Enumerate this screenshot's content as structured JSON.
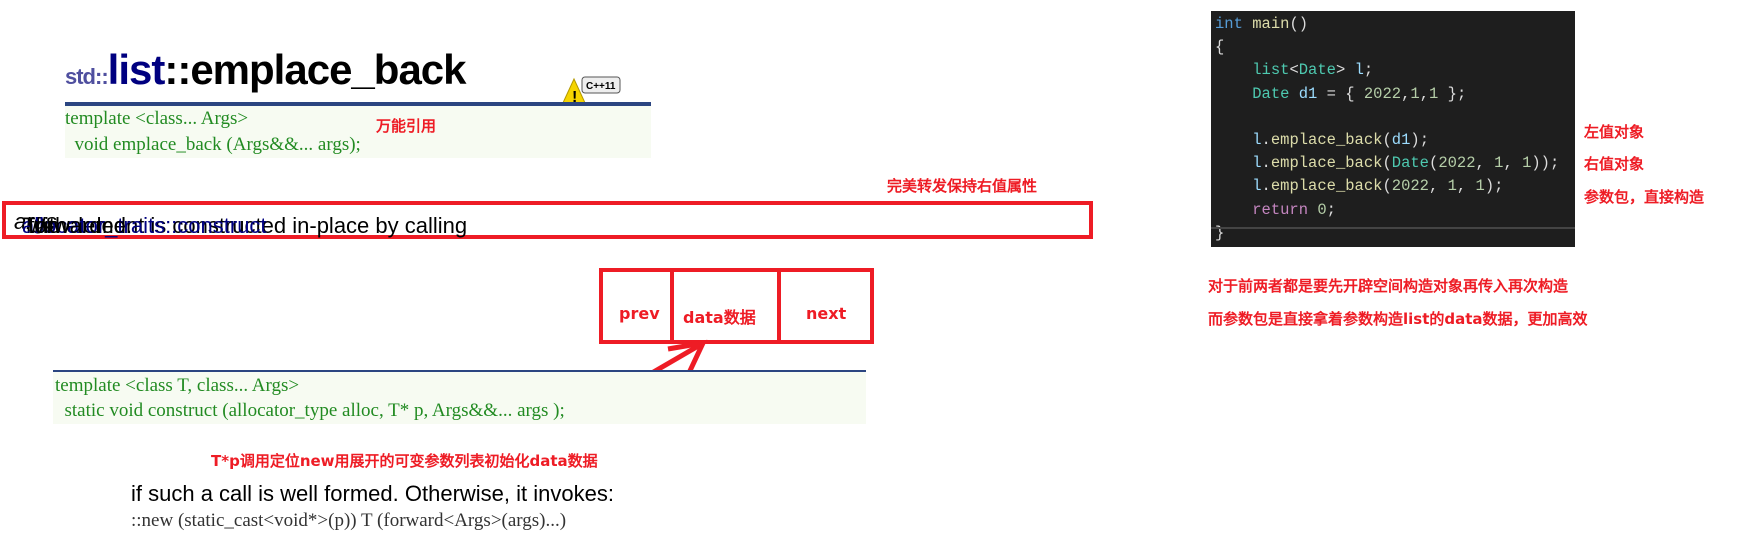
{
  "doc": {
    "title_ns": "std::",
    "title_class": "list",
    "title_sep": "::",
    "title_member": "emplace_back",
    "badge": "C++11",
    "sig_line1": "template <class... Args>",
    "sig_line2": "  void emplace_back (Args&&... args);",
    "desc_pre": "The element is constructed in-place by calling ",
    "desc_link": "allocator_traits::construct",
    "desc_mid": " with ",
    "desc_em": "args",
    "desc_post": " forwarded.",
    "construct_line1": "template <class T, class... Args>",
    "construct_line2": "  static void construct (allocator_type alloc, T* p, Args&&... args );",
    "otherwise": "if such a call is well formed. Otherwise, it invokes:",
    "new_expr": "::new (static_cast<void*>(p)) T (forward<Args>(args)...)"
  },
  "annotations": {
    "universal_ref": "万能引用",
    "perfect_forward": "完美转发保持右值属性",
    "placement_new": "T*p调用定位new用展开的可变参数列表初始化data数据",
    "lvalue": "左值对象",
    "rvalue": "右值对象",
    "pack": "参数包，直接构造",
    "note1": "对于前两者都是要先开辟空间构造对象再传入再次构造",
    "note2": "而参数包是直接拿着参数构造list的data数据，更加高效"
  },
  "node": {
    "prev": "prev",
    "data": "data数据",
    "next": "next"
  },
  "code": [
    [
      [
        "int",
        "kw"
      ],
      [
        " ",
        "p"
      ],
      [
        "main",
        "fn"
      ],
      [
        "()",
        "p"
      ]
    ],
    [
      [
        "{",
        "p"
      ]
    ],
    [
      [
        "    ",
        "p"
      ],
      [
        "list",
        "ty"
      ],
      [
        "<",
        "p"
      ],
      [
        "Date",
        "ty"
      ],
      [
        "> ",
        "p"
      ],
      [
        "l",
        "var"
      ],
      [
        ";",
        "p"
      ]
    ],
    [
      [
        "    ",
        "p"
      ],
      [
        "Date",
        "ty"
      ],
      [
        " ",
        "p"
      ],
      [
        "d1",
        "var"
      ],
      [
        " = { ",
        "p"
      ],
      [
        "2022",
        "num"
      ],
      [
        ",",
        "p"
      ],
      [
        "1",
        "num"
      ],
      [
        ",",
        "p"
      ],
      [
        "1",
        "num"
      ],
      [
        " };",
        "p"
      ]
    ],
    [],
    [
      [
        "    ",
        "p"
      ],
      [
        "l",
        "var"
      ],
      [
        ".",
        "p"
      ],
      [
        "emplace_back",
        "fn"
      ],
      [
        "(",
        "p"
      ],
      [
        "d1",
        "var"
      ],
      [
        ");",
        "p"
      ]
    ],
    [
      [
        "    ",
        "p"
      ],
      [
        "l",
        "var"
      ],
      [
        ".",
        "p"
      ],
      [
        "emplace_back",
        "fn"
      ],
      [
        "(",
        "p"
      ],
      [
        "Date",
        "ty"
      ],
      [
        "(",
        "p"
      ],
      [
        "2022",
        "num"
      ],
      [
        ", ",
        "p"
      ],
      [
        "1",
        "num"
      ],
      [
        ", ",
        "p"
      ],
      [
        "1",
        "num"
      ],
      [
        "));",
        "p"
      ]
    ],
    [
      [
        "    ",
        "p"
      ],
      [
        "l",
        "var"
      ],
      [
        ".",
        "p"
      ],
      [
        "emplace_back",
        "fn"
      ],
      [
        "(",
        "p"
      ],
      [
        "2022",
        "num"
      ],
      [
        ", ",
        "p"
      ],
      [
        "1",
        "num"
      ],
      [
        ", ",
        "p"
      ],
      [
        "1",
        "num"
      ],
      [
        ");",
        "p"
      ]
    ],
    [
      [
        "    ",
        "p"
      ],
      [
        "return",
        "ret"
      ],
      [
        " ",
        "p"
      ],
      [
        "0",
        "num"
      ],
      [
        ";",
        "p"
      ]
    ],
    [
      [
        "}",
        "p"
      ]
    ]
  ],
  "colors": {
    "annotation": "#ee1c25",
    "ide_bg": "#1e1e1e",
    "rule": "#2b4581",
    "code_green": "#228b22"
  }
}
